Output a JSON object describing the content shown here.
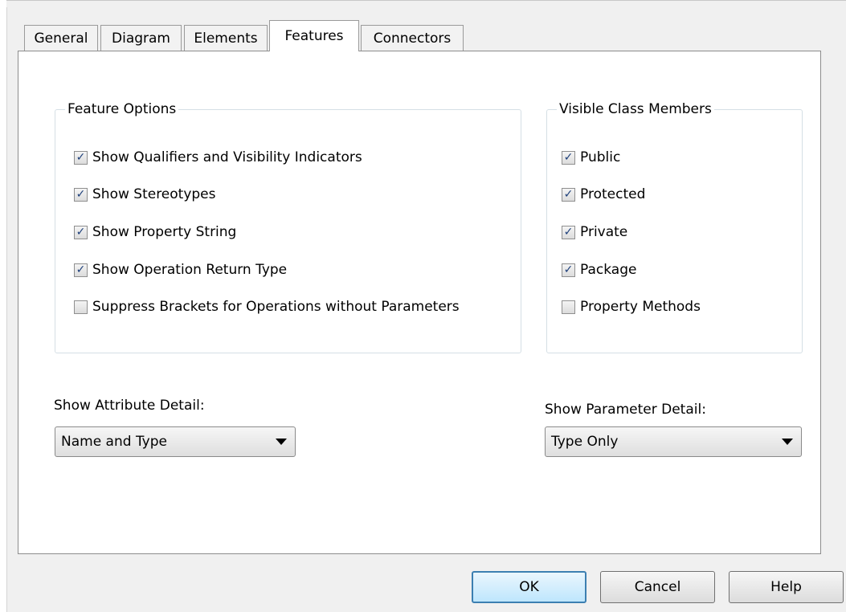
{
  "tabs": [
    {
      "label": "General"
    },
    {
      "label": "Diagram"
    },
    {
      "label": "Elements"
    },
    {
      "label": "Features",
      "active": true
    },
    {
      "label": "Connectors"
    }
  ],
  "feature_options": {
    "legend": "Feature Options",
    "items": [
      {
        "label": "Show Qualifiers and Visibility Indicators",
        "checked": true
      },
      {
        "label": "Show Stereotypes",
        "checked": true
      },
      {
        "label": "Show Property String",
        "checked": true
      },
      {
        "label": "Show Operation Return Type",
        "checked": true
      },
      {
        "label": "Suppress Brackets for Operations without Parameters",
        "checked": false
      }
    ]
  },
  "visible_members": {
    "legend": "Visible Class Members",
    "items": [
      {
        "label": "Public",
        "checked": true
      },
      {
        "label": "Protected",
        "checked": true
      },
      {
        "label": "Private",
        "checked": true
      },
      {
        "label": "Package",
        "checked": true
      },
      {
        "label": "Property Methods",
        "checked": false
      }
    ]
  },
  "attribute_detail": {
    "label": "Show Attribute Detail:",
    "value": "Name and Type"
  },
  "parameter_detail": {
    "label": "Show Parameter Detail:",
    "value": "Type Only"
  },
  "buttons": {
    "ok": "OK",
    "cancel": "Cancel",
    "help": "Help"
  },
  "check_glyph": "✓"
}
